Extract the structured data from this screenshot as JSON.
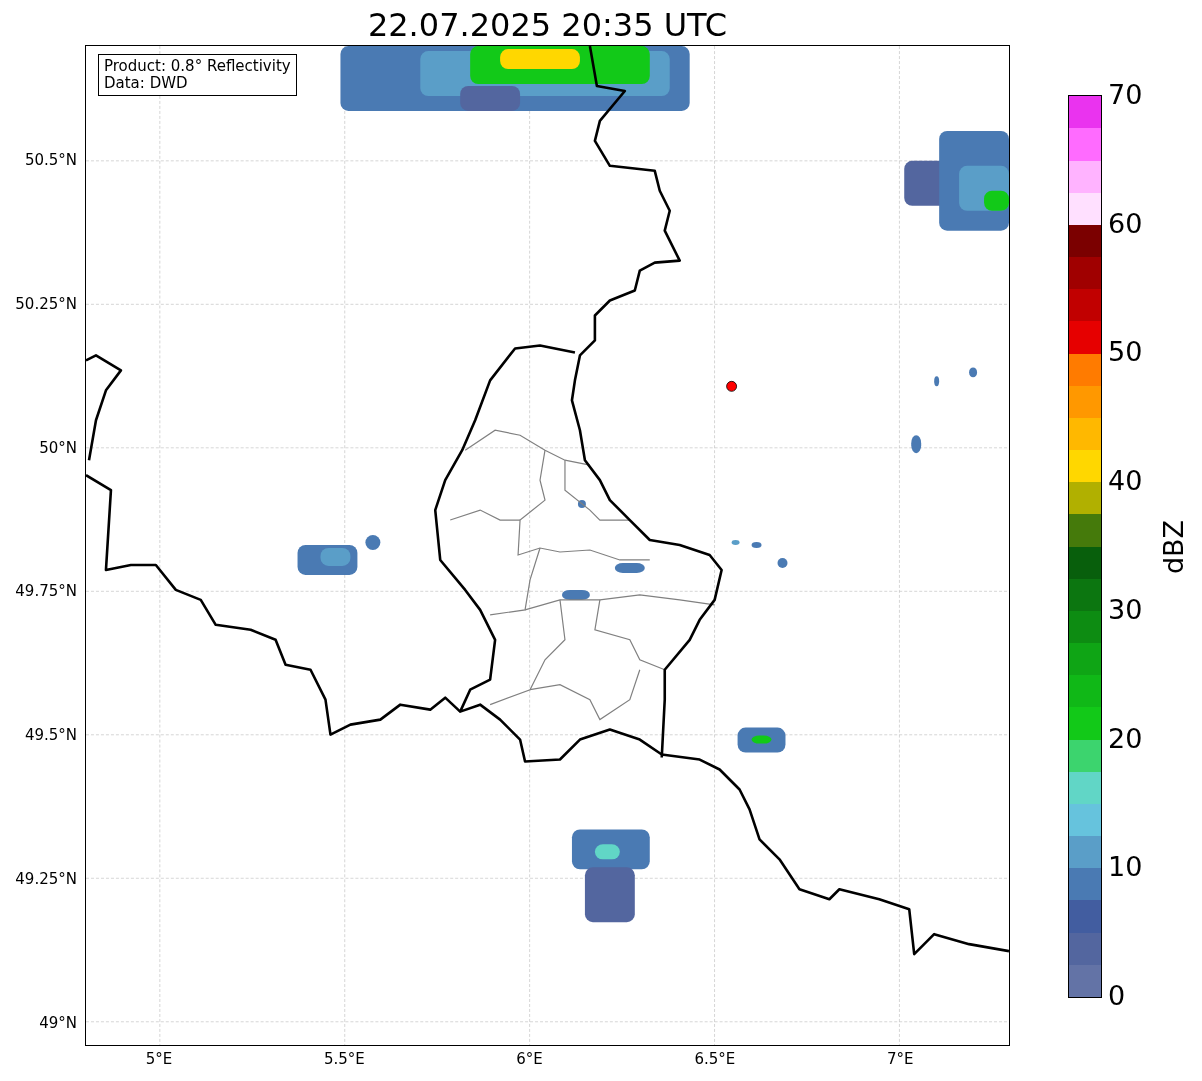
{
  "title": "22.07.2025 20:35 UTC",
  "info_box": {
    "lines": [
      "Product: 0.8° Reflectivity",
      "Data: DWD"
    ]
  },
  "map": {
    "y_ticks": [
      "50.5°N",
      "50.25°N",
      "50°N",
      "49.75°N",
      "49.5°N",
      "49.25°N",
      "49°N"
    ],
    "x_ticks": [
      "5°E",
      "5.5°E",
      "6°E",
      "6.5°E",
      "7°E"
    ]
  },
  "colorbar": {
    "label": "dBZ",
    "ticks": [
      "70",
      "60",
      "50",
      "40",
      "30",
      "20",
      "10",
      "0"
    ],
    "segments": [
      {
        "color": "#6373a6"
      },
      {
        "color": "#53669f"
      },
      {
        "color": "#425da0"
      },
      {
        "color": "#4a7ab3"
      },
      {
        "color": "#5a9ec8"
      },
      {
        "color": "#66c3dd"
      },
      {
        "color": "#61d6c6"
      },
      {
        "color": "#3cd46e"
      },
      {
        "color": "#12c918"
      },
      {
        "color": "#10b817"
      },
      {
        "color": "#0fa515"
      },
      {
        "color": "#0d8c12"
      },
      {
        "color": "#0c7610"
      },
      {
        "color": "#085f0c"
      },
      {
        "color": "#457a0b"
      },
      {
        "color": "#b1b000"
      },
      {
        "color": "#ffd700"
      },
      {
        "color": "#ffb800"
      },
      {
        "color": "#ff9800"
      },
      {
        "color": "#ff7b00"
      },
      {
        "color": "#e60000"
      },
      {
        "color": "#c10000"
      },
      {
        "color": "#a00000"
      },
      {
        "color": "#7b0000"
      },
      {
        "color": "#ffe0ff"
      },
      {
        "color": "#ffb3ff"
      },
      {
        "color": "#ff6bff"
      },
      {
        "color": "#ea33ef"
      }
    ]
  }
}
